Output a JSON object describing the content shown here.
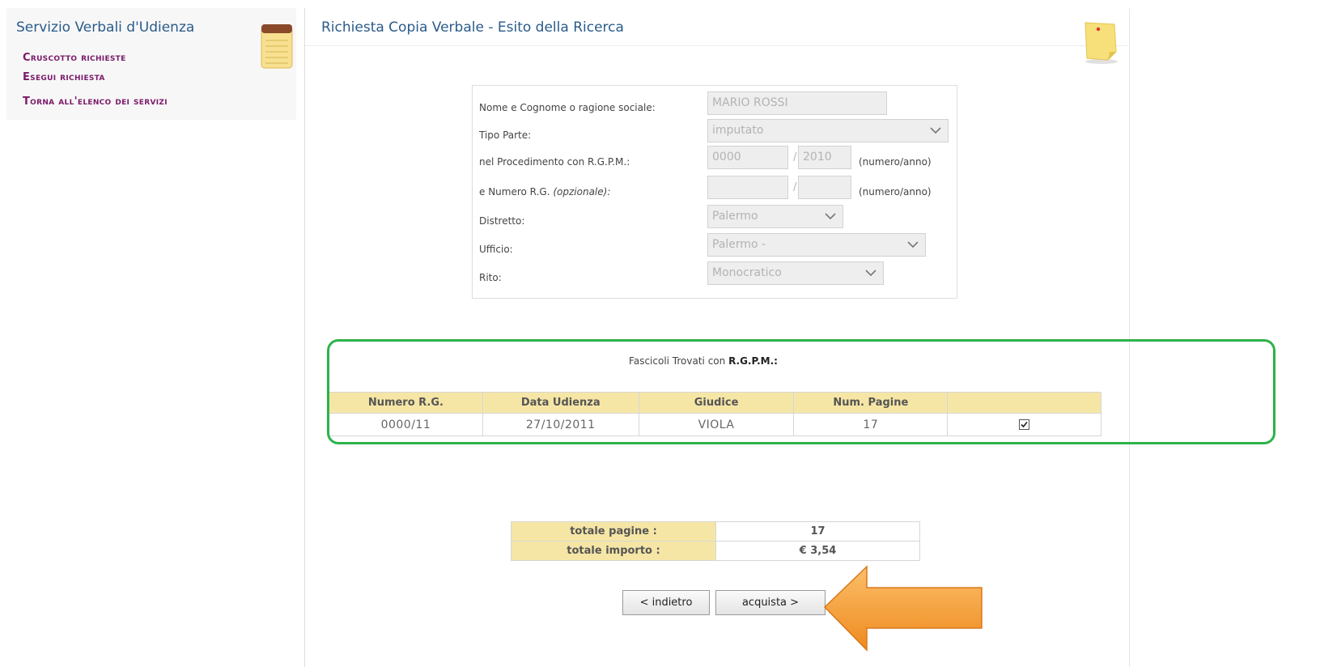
{
  "sidebar": {
    "title": "Servizio Verbali d'Udienza",
    "links": [
      "Cruscotto richieste",
      "Esegui richiesta",
      "Torna all'elenco dei servizi"
    ]
  },
  "page": {
    "title": "Richiesta Copia Verbale - Esito della Ricerca"
  },
  "form": {
    "name_label": "Nome e Cognome o ragione sociale:",
    "name_value": "MARIO ROSSI",
    "tipo_label": "Tipo Parte:",
    "tipo_value": "imputato",
    "rgpm_label": "nel Procedimento con R.G.P.M.:",
    "rgpm_number": "0000",
    "rgpm_year": "2010",
    "rgpm_hint": "(numero/anno)",
    "rg_label": "e Numero R.G.",
    "rg_optional": "(opzionale):",
    "rg_number": "",
    "rg_year": "",
    "rg_hint": "(numero/anno)",
    "distretto_label": "Distretto:",
    "distretto_value": "Palermo",
    "ufficio_label": "Ufficio:",
    "ufficio_value": "Palermo -",
    "rito_label": "Rito:",
    "rito_value": "Monocratico",
    "slash": "/"
  },
  "results": {
    "caption_prefix": "Fascicoli Trovati con ",
    "caption_bold": "R.G.P.M.:",
    "headers": [
      "Numero R.G.",
      "Data Udienza",
      "Giudice",
      "Num. Pagine",
      ""
    ],
    "rows": [
      {
        "numero_rg": "0000/11",
        "data_udienza": "27/10/2011",
        "giudice": "VIOLA",
        "num_pagine": "17",
        "selected": true
      }
    ]
  },
  "totals": {
    "pages_label": "totale pagine :",
    "pages_value": "17",
    "amount_label": "totale importo :",
    "amount_value": "€ 3,54"
  },
  "buttons": {
    "back": "< indietro",
    "buy": "acquista >"
  },
  "colors": {
    "title_blue": "#2a5b8a",
    "link_purple": "#7a1a6a",
    "table_header": "#f6e6a6",
    "highlight_green": "#2db34a",
    "arrow_orange": "#f39a2b"
  }
}
